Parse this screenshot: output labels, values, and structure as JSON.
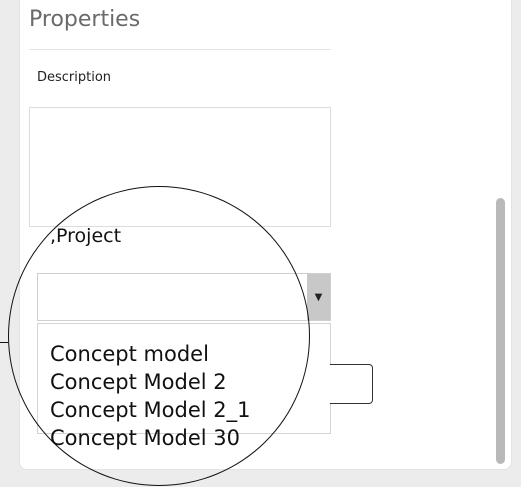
{
  "section": {
    "title": "Properties"
  },
  "description": {
    "label": "Description",
    "value": ""
  },
  "project": {
    "label": ",Project",
    "selected_value": "",
    "options": [
      "Concept model",
      "Concept Model 2",
      "Concept Model 2_1",
      "Concept Model 30"
    ]
  },
  "icons": {
    "dropdown_arrow": "caret-down-icon",
    "dropdown_glyph": "▼"
  },
  "colors": {
    "panel_background": "#ffffff",
    "page_background": "#ececec",
    "dropdown_arrow_background": "#c8c8c8",
    "scrollbar_thumb": "#b9b9b9"
  }
}
